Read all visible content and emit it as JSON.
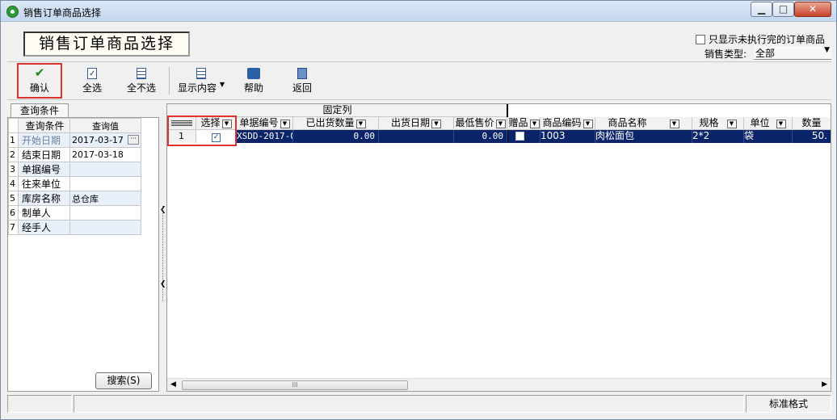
{
  "window": {
    "title": "销售订单商品选择",
    "controls": [
      "minimize",
      "maximize",
      "close"
    ]
  },
  "banner": "销售订单商品选择",
  "filter": {
    "only_unexecuted_label": "只显示未执行完的订单商品",
    "only_unexecuted_checked": false,
    "sales_type_label": "销售类型:",
    "sales_type_value": "全部"
  },
  "toolbar": {
    "confirm": "确认",
    "select_all": "全选",
    "select_none": "全不选",
    "display_content": "显示内容",
    "help": "帮助",
    "back": "返回"
  },
  "query": {
    "tab_label": "查询条件",
    "col_condition": "查询条件",
    "col_value": "查询值",
    "rows": [
      {
        "n": "1",
        "cond": "开始日期",
        "val": "2017-03-17"
      },
      {
        "n": "2",
        "cond": "结束日期",
        "val": "2017-03-18"
      },
      {
        "n": "3",
        "cond": "单据编号",
        "val": ""
      },
      {
        "n": "4",
        "cond": "往来单位",
        "val": ""
      },
      {
        "n": "5",
        "cond": "库房名称",
        "val": "总仓库"
      },
      {
        "n": "6",
        "cond": "制单人",
        "val": ""
      },
      {
        "n": "7",
        "cond": "经手人",
        "val": ""
      }
    ],
    "search_button": "搜索(S)"
  },
  "grid": {
    "fixed_columns_label": "固定列",
    "columns": {
      "select": "选择",
      "doc_no": "单据编号",
      "shipped_qty": "已出货数量",
      "ship_date": "出货日期",
      "min_price": "最低售价",
      "gift": "赠品",
      "product_code": "商品编码",
      "product_name": "商品名称",
      "spec": "规格",
      "unit": "单位",
      "quantity": "数量"
    },
    "rows": [
      {
        "n": "1",
        "selected": true,
        "doc_no": "XSDD-2017-0",
        "shipped_qty": "0.00",
        "ship_date": "",
        "min_price": "0.00",
        "gift": false,
        "product_code": "1003",
        "product_name": "肉松面包",
        "spec": "2*2",
        "unit": "袋",
        "quantity": "50."
      }
    ],
    "scroll_grip": "III"
  },
  "status": {
    "format_label": "标准格式"
  },
  "icons": {
    "confirm": "check-icon",
    "select_all": "checkbox-checked-icon",
    "select_none": "list-icon",
    "display_content": "table-icon",
    "help": "book-icon",
    "back": "exit-door-icon"
  },
  "colors": {
    "selection": "#0a246a",
    "highlight_box": "#e0322e"
  }
}
